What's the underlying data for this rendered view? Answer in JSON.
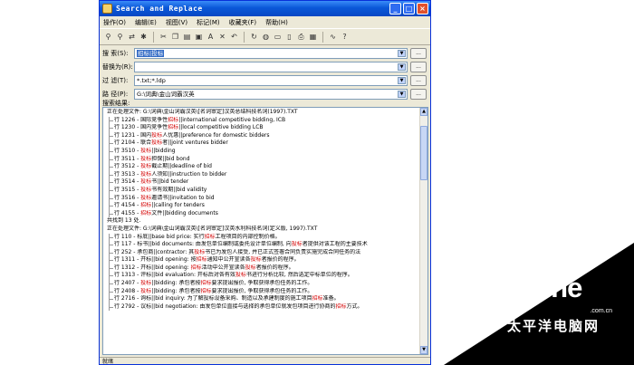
{
  "window": {
    "title": "Search and Replace"
  },
  "menu": [
    {
      "label": "操作(O)"
    },
    {
      "label": "编辑(E)"
    },
    {
      "label": "视图(V)"
    },
    {
      "label": "标记(M)"
    },
    {
      "label": "收藏夹(F)"
    },
    {
      "label": "帮助(H)"
    }
  ],
  "toolbar": {
    "icons": [
      "binoculars-icon",
      "find-next-icon",
      "replace-icon",
      "special-replace-icon",
      "scissors-icon",
      "copy-icon",
      "paste-icon",
      "zip-icon",
      "text-icon",
      "delete-icon",
      "undo-icon",
      "refresh-icon",
      "globe-icon",
      "folder-icon",
      "document-icon",
      "print-icon",
      "calendar-icon",
      "wave-icon",
      "help-icon"
    ]
  },
  "fields": {
    "search": {
      "label": "搜 索(S):",
      "value": "招标|投标"
    },
    "replace": {
      "label": "替换为(R):",
      "value": ""
    },
    "filter": {
      "label": "过 滤(T):",
      "value": "*.txt;*.ldp"
    },
    "path": {
      "label": "路 径(P):",
      "value": "G:\\词典\\金山词霸汉英"
    }
  },
  "results_label": "搜索结果:",
  "results": [
    {
      "type": "file",
      "pre": "正在处理文件: G:\\词典\\金山词霸汉英\\[名词审定]汉英总结科技名词(1997).TXT"
    },
    {
      "type": "hit",
      "pre": "行 1226 - 国际竞争性",
      "kw": "招标",
      "post": "||international competitive bidding, ICB"
    },
    {
      "type": "hit",
      "pre": "行 1230 - 国内竞争性",
      "kw": "招标",
      "post": "||local competitive bidding LCB"
    },
    {
      "type": "hit",
      "pre": "行 1231 - 国内",
      "kw": "投标",
      "post": "人优惠||preference for domestic bidders"
    },
    {
      "type": "hit",
      "pre": "行 2104 - 联合",
      "kw": "投标",
      "post": "者||joint ventures bidder"
    },
    {
      "type": "hit",
      "pre": "行 3510 - ",
      "kw": "投标",
      "post": "||bidding"
    },
    {
      "type": "hit",
      "pre": "行 3511 - ",
      "kw": "投标",
      "post": "担保||bid bond"
    },
    {
      "type": "hit",
      "pre": "行 3512 - ",
      "kw": "投标",
      "post": "截止期||deadline of bid"
    },
    {
      "type": "hit",
      "pre": "行 3513 - ",
      "kw": "投标",
      "post": "人须知||instruction to bidder"
    },
    {
      "type": "hit",
      "pre": "行 3514 - ",
      "kw": "投标",
      "post": "书||bid  tender"
    },
    {
      "type": "hit",
      "pre": "行 3515 - ",
      "kw": "投标",
      "post": "书有效期||bid validity"
    },
    {
      "type": "hit",
      "pre": "行 3516 - ",
      "kw": "投标",
      "post": "邀请书||invitation to bid"
    },
    {
      "type": "hit",
      "pre": "行 4154 - ",
      "kw": "招标",
      "post": "||calling for tenders"
    },
    {
      "type": "hit",
      "pre": "行 4155 - ",
      "kw": "招标",
      "post": "文件||bidding documents"
    },
    {
      "type": "file",
      "pre": "  共找到 13 处."
    },
    {
      "type": "file",
      "pre": "正在处理文件: G:\\词典\\金山词霸汉英\\[名词审定]汉英水利科技名词(定义版, 1997).TXT"
    },
    {
      "type": "hit",
      "pre": "行 110 - 标底||base bid price: 实行",
      "kw": "招标",
      "post": "工程项目的内部控制价格。"
    },
    {
      "type": "hit",
      "pre": "行 117 - 标书||bid documents: 由发包单位编制或委托设计单位编制, 向",
      "kw": "投标",
      "post": "者提供对该工程的主要技术"
    },
    {
      "type": "hit",
      "pre": "行 252 - 承包商||contractor: 其",
      "kw": "投标",
      "post": "书已为发包人接受, 并已正式签署合同负责实施完成合同任务的法"
    },
    {
      "type": "hit",
      "pre": "行 1311 - 开标||bid opening: 按",
      "kw": "招标",
      "post": "通知中公开宣读各",
      "kw2": "投标",
      "post2": "者报价的程序。"
    },
    {
      "type": "hit",
      "pre": "行 1312 - 开标||bid opening: ",
      "kw": "招标",
      "post": "活动中公开宣读各",
      "kw2": "投标",
      "post2": "者报价的程序。"
    },
    {
      "type": "hit",
      "pre": "行 1313 - 评标||bid evaluation: 开标后对各有效",
      "kw": "投标",
      "post": "书进行分析比较, 然后选定中标单位的程序。"
    },
    {
      "type": "hit",
      "pre": "行 2407 - ",
      "kw": "投标",
      "post": "||bidding: 承包者按",
      "kw2": "招标",
      "post2": "要求提出报价, 争取获得承包任务的工作。"
    },
    {
      "type": "hit",
      "pre": "行 2408 - ",
      "kw": "投标",
      "post": "||bidding: 承包者按",
      "kw2": "招标",
      "post2": "要求提出报价, 争取获得承包任务的工作。"
    },
    {
      "type": "hit",
      "pre": "行 2716 - 询标||bid inquiry: 为了解投标设备采购、制造以及承建制度的施工项目",
      "kw": "招标",
      "post": "准备。"
    },
    {
      "type": "hit",
      "pre": "行 2792 - 议标||bid negotiation: 由发包单位直接与选择的承包单位就发包项目进行协商的",
      "kw": "招标",
      "post": "方式。"
    }
  ],
  "status": "就绪",
  "watermark": {
    "logo": "PConline",
    "cn": "太平洋电脑网",
    "url": ".com.cn"
  }
}
